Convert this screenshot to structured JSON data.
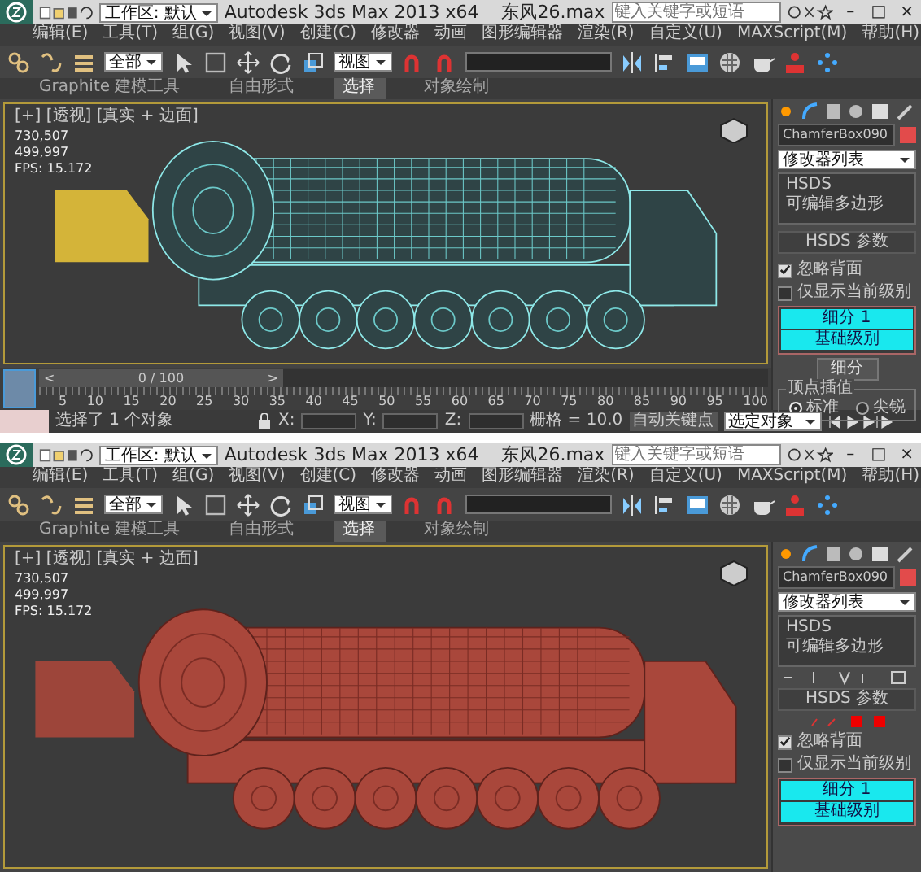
{
  "windows": [
    {
      "title": "Autodesk 3ds Max  2013 x64",
      "file": "东风26.max",
      "workspace": "工作区: 默认",
      "search": {
        "placeholder": "键入关键字或短语"
      },
      "window_buttons": [
        "–",
        "□",
        "×"
      ],
      "menu": [
        "编辑(E)",
        "工具(T)",
        "组(G)",
        "视图(V)",
        "创建(C)",
        "修改器",
        "动画",
        "图形编辑器",
        "渲染(R)",
        "自定义(U)",
        "MAXScript(M)",
        "帮助(H)"
      ],
      "toolbar": {
        "selection_filter": "全部",
        "coordinate_system": "视图"
      },
      "ribbon_tabs": [
        {
          "label": "Graphite 建模工具",
          "selected": false
        },
        {
          "label": "自由形式",
          "selected": false
        },
        {
          "label": "选择",
          "selected": true
        },
        {
          "label": "对象绘制",
          "selected": false
        }
      ],
      "viewport": {
        "label": "[+] [透视] [真实 + 边面]",
        "stats": [
          "730,507",
          "499,997"
        ],
        "fps": "FPS: 15.172",
        "kind": "wireframe"
      },
      "command_panel": {
        "object_name": "ChamferBox090",
        "modifier_list": "修改器列表",
        "stack": [
          "HSDS",
          "可编辑多边形"
        ],
        "rollout": "HSDS 参数",
        "options": [
          {
            "label": "忽略背面",
            "checked": true
          },
          {
            "label": "仅显示当前级别",
            "checked": false
          }
        ],
        "levels": [
          "细分 1",
          "基础级别"
        ],
        "subdivide_button": "细分",
        "interpolation": {
          "title": "顶点插值",
          "options": [
            {
              "label": "标准",
              "selected": true
            },
            {
              "label": "尖锐",
              "selected": false
            }
          ]
        }
      },
      "timeline": {
        "position": "0 / 100",
        "previous": "<",
        "next": ">",
        "ticks": [
          "5",
          "10",
          "15",
          "20",
          "25",
          "30",
          "35",
          "40",
          "45",
          "50",
          "55",
          "60",
          "65",
          "70",
          "75",
          "80",
          "85",
          "90",
          "95",
          "100"
        ]
      },
      "status_bar": {
        "message": "选择了 1 个对象",
        "x": "X:",
        "y": "Y:",
        "z": "Z:",
        "grid": "栅格 = 10.0",
        "auto_key": "自动关键点",
        "key_filter": "选定对象"
      }
    },
    {
      "title": "Autodesk 3ds Max  2013 x64",
      "file": "东风26.max",
      "workspace": "工作区: 默认",
      "search": {
        "placeholder": "键入关键字或短语"
      },
      "window_buttons": [
        "–",
        "□",
        "×"
      ],
      "menu": [
        "编辑(E)",
        "工具(T)",
        "组(G)",
        "视图(V)",
        "创建(C)",
        "修改器",
        "动画",
        "图形编辑器",
        "渲染(R)",
        "自定义(U)",
        "MAXScript(M)",
        "帮助(H)"
      ],
      "toolbar": {
        "selection_filter": "全部",
        "coordinate_system": "视图"
      },
      "ribbon_tabs": [
        {
          "label": "Graphite 建模工具",
          "selected": false
        },
        {
          "label": "自由形式",
          "selected": false
        },
        {
          "label": "选择",
          "selected": true
        },
        {
          "label": "对象绘制",
          "selected": false
        }
      ],
      "viewport": {
        "label": "[+] [透视] [真实 + 边面]",
        "stats": [
          "730,507",
          "499,997"
        ],
        "fps": "FPS: 15.172",
        "kind": "solid"
      },
      "command_panel": {
        "object_name": "ChamferBox090",
        "modifier_list": "修改器列表",
        "stack": [
          "HSDS",
          "可编辑多边形"
        ],
        "rollout": "HSDS 参数",
        "options": [
          {
            "label": "忽略背面",
            "checked": true
          },
          {
            "label": "仅显示当前级别",
            "checked": false
          }
        ],
        "levels": [
          "细分 1",
          "基础级别"
        ]
      }
    }
  ]
}
